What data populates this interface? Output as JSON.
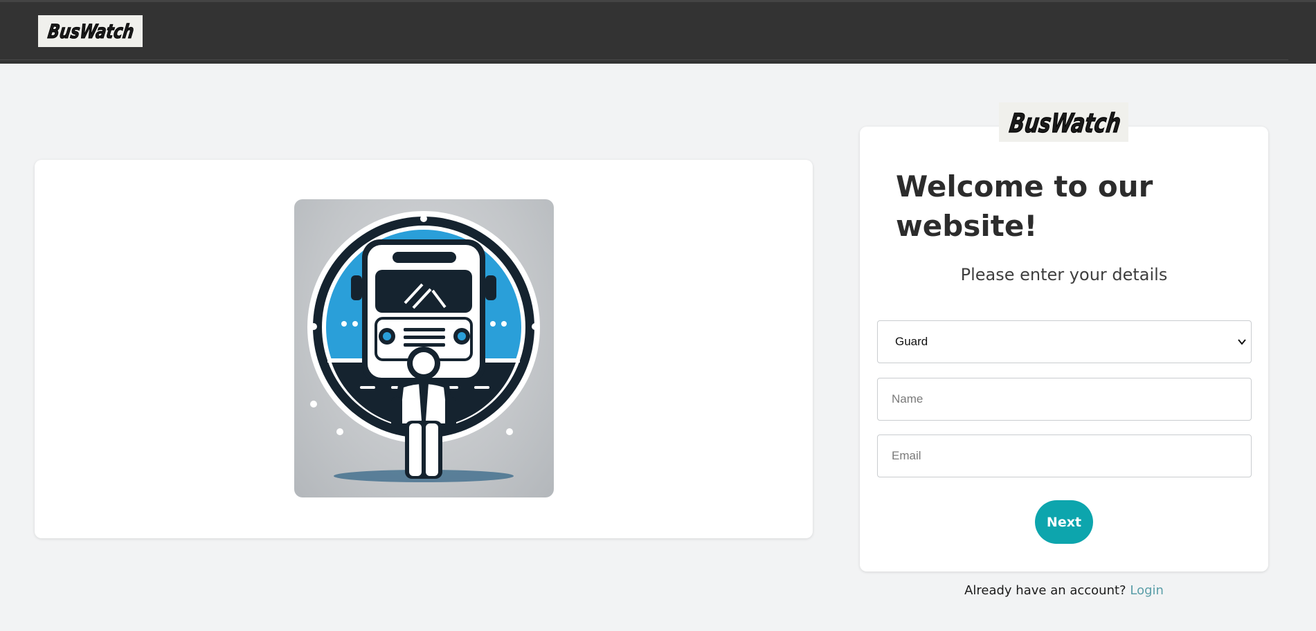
{
  "header": {
    "logo_text": "BusWatch"
  },
  "hero": {
    "image_icon": "bus-guard-illustration"
  },
  "form": {
    "logo_text": "BusWatch",
    "title": "Welcome to our website!",
    "subtitle": "Please enter your details",
    "role_select": {
      "selected": "Guard",
      "options": [
        "Guard"
      ]
    },
    "name_placeholder": "Name",
    "email_placeholder": "Email",
    "next_label": "Next"
  },
  "footer": {
    "prompt": "Already have an account?",
    "login_label": "Login"
  },
  "colors": {
    "topbar": "#333333",
    "background": "#f2f3f4",
    "accent": "#0da5ad",
    "link": "#5b9ea8",
    "bus_blue": "#2a9fd9",
    "bus_dark": "#15232f"
  }
}
